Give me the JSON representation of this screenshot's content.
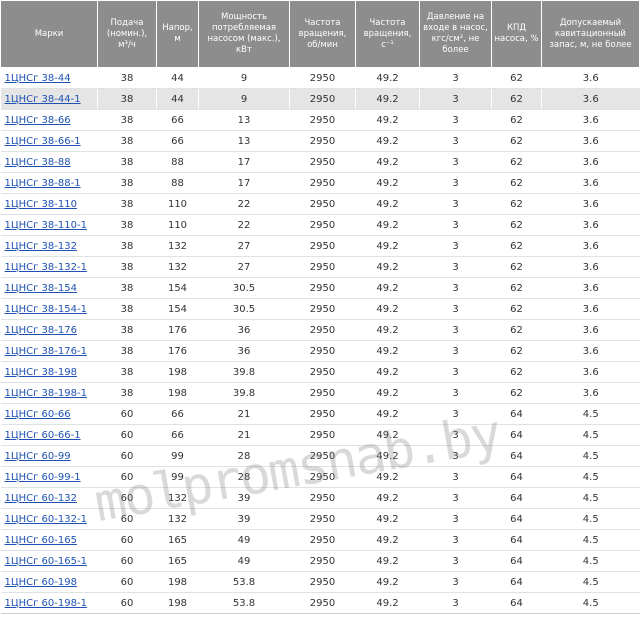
{
  "table": {
    "headers": [
      "Марки",
      "Подача (номин.), м³/ч",
      "Напор, м",
      "Мощность потребляемая насосом (макс.), кВт",
      "Частота вращения, об/мин",
      "Частота вращения, с⁻¹",
      "Давление на входе в насос, кгс/см², не более",
      "КПД насоса, %",
      "Допускаемый кавитационный запас, м, не более"
    ],
    "rows": [
      [
        "1ЦНСг 38-44",
        "38",
        "44",
        "9",
        "2950",
        "49.2",
        "3",
        "62",
        "3.6"
      ],
      [
        "1ЦНСг 38-44-1",
        "38",
        "44",
        "9",
        "2950",
        "49.2",
        "3",
        "62",
        "3.6"
      ],
      [
        "1ЦНСг 38-66",
        "38",
        "66",
        "13",
        "2950",
        "49.2",
        "3",
        "62",
        "3.6"
      ],
      [
        "1ЦНСг 38-66-1",
        "38",
        "66",
        "13",
        "2950",
        "49.2",
        "3",
        "62",
        "3.6"
      ],
      [
        "1ЦНСг 38-88",
        "38",
        "88",
        "17",
        "2950",
        "49.2",
        "3",
        "62",
        "3.6"
      ],
      [
        "1ЦНСг 38-88-1",
        "38",
        "88",
        "17",
        "2950",
        "49.2",
        "3",
        "62",
        "3.6"
      ],
      [
        "1ЦНСг 38-110",
        "38",
        "110",
        "22",
        "2950",
        "49.2",
        "3",
        "62",
        "3.6"
      ],
      [
        "1ЦНСг 38-110-1",
        "38",
        "110",
        "22",
        "2950",
        "49.2",
        "3",
        "62",
        "3.6"
      ],
      [
        "1ЦНСг 38-132",
        "38",
        "132",
        "27",
        "2950",
        "49.2",
        "3",
        "62",
        "3.6"
      ],
      [
        "1ЦНСг 38-132-1",
        "38",
        "132",
        "27",
        "2950",
        "49.2",
        "3",
        "62",
        "3.6"
      ],
      [
        "1ЦНСг 38-154",
        "38",
        "154",
        "30.5",
        "2950",
        "49.2",
        "3",
        "62",
        "3.6"
      ],
      [
        "1ЦНСг 38-154-1",
        "38",
        "154",
        "30.5",
        "2950",
        "49.2",
        "3",
        "62",
        "3.6"
      ],
      [
        "1ЦНСг 38-176",
        "38",
        "176",
        "36",
        "2950",
        "49.2",
        "3",
        "62",
        "3.6"
      ],
      [
        "1ЦНСг 38-176-1",
        "38",
        "176",
        "36",
        "2950",
        "49.2",
        "3",
        "62",
        "3.6"
      ],
      [
        "1ЦНСг 38-198",
        "38",
        "198",
        "39.8",
        "2950",
        "49.2",
        "3",
        "62",
        "3.6"
      ],
      [
        "1ЦНСг 38-198-1",
        "38",
        "198",
        "39.8",
        "2950",
        "49.2",
        "3",
        "62",
        "3.6"
      ],
      [
        "1ЦНСг 60-66",
        "60",
        "66",
        "21",
        "2950",
        "49.2",
        "3",
        "64",
        "4.5"
      ],
      [
        "1ЦНСг 60-66-1",
        "60",
        "66",
        "21",
        "2950",
        "49.2",
        "3",
        "64",
        "4.5"
      ],
      [
        "1ЦНСг 60-99",
        "60",
        "99",
        "28",
        "2950",
        "49.2",
        "3",
        "64",
        "4.5"
      ],
      [
        "1ЦНСг 60-99-1",
        "60",
        "99",
        "28",
        "2950",
        "49.2",
        "3",
        "64",
        "4.5"
      ],
      [
        "1ЦНСг 60-132",
        "60",
        "132",
        "39",
        "2950",
        "49.2",
        "3",
        "64",
        "4.5"
      ],
      [
        "1ЦНСг 60-132-1",
        "60",
        "132",
        "39",
        "2950",
        "49.2",
        "3",
        "64",
        "4.5"
      ],
      [
        "1ЦНСг 60-165",
        "60",
        "165",
        "49",
        "2950",
        "49.2",
        "3",
        "64",
        "4.5"
      ],
      [
        "1ЦНСг 60-165-1",
        "60",
        "165",
        "49",
        "2950",
        "49.2",
        "3",
        "64",
        "4.5"
      ],
      [
        "1ЦНСг 60-198",
        "60",
        "198",
        "53.8",
        "2950",
        "49.2",
        "3",
        "64",
        "4.5"
      ],
      [
        "1ЦНСг 60-198-1",
        "60",
        "198",
        "53.8",
        "2950",
        "49.2",
        "3",
        "64",
        "4.5"
      ]
    ],
    "highlighted_row": 1
  },
  "watermark": "molpromsnab.by",
  "colors": {
    "header_bg": "#8d8d8d",
    "link": "#1f52b3",
    "highlight": "#e5e5e5"
  }
}
